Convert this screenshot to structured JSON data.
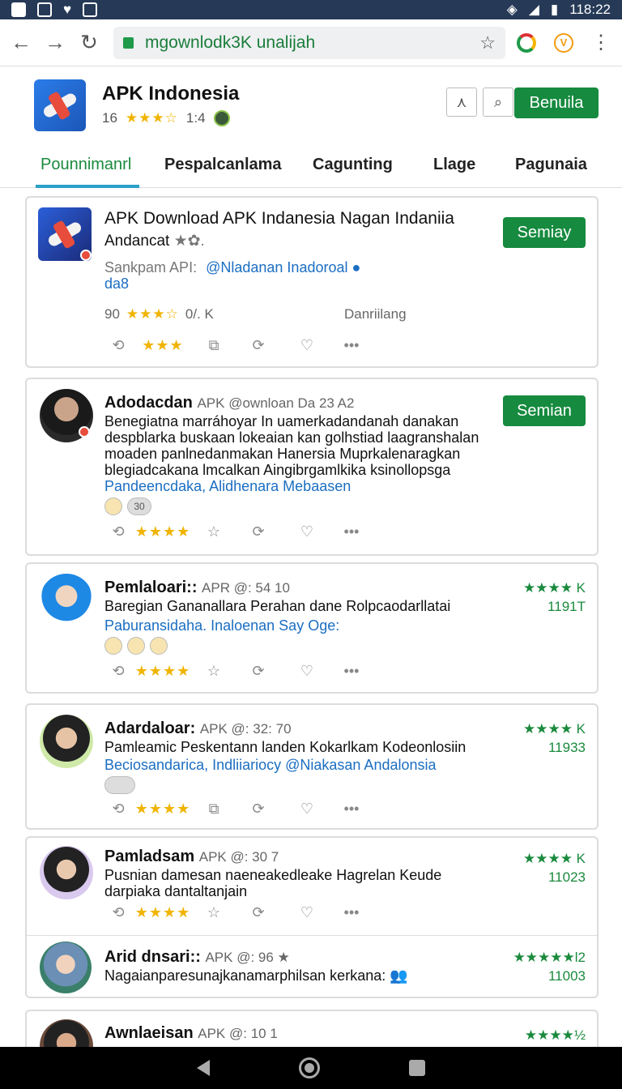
{
  "status_bar": {
    "time": "118:22"
  },
  "browser": {
    "url": "mgownlodk3K unalijah"
  },
  "app": {
    "title": "APK Indonesia",
    "count": "16",
    "stars": "★★★☆",
    "rating": "1:4",
    "action_label": "Benuila"
  },
  "tabs": [
    "Pounnimanrl",
    "Pespalcanlama",
    "Cagunting",
    "Llage",
    "Pagunaia"
  ],
  "featured": {
    "title": "APK Download APK Indanesia Nagan Indaniia",
    "subtitle": "Andancat",
    "source_label": "Sankpam API:",
    "source_link": "@Nladanan Inadoroal",
    "source_extra": "da8",
    "count": "90",
    "stars": "★★★☆",
    "size": "0/. K",
    "status": "Danriilang",
    "button": "Semiay"
  },
  "posts": [
    {
      "author": "Adodacdan",
      "handle": "APK @ownloan Da 23 A2",
      "body": "Benegiatna marráhoyar In uamerkadandanah danakan despblarka buskaan lokeaian kan golhstiad laagranshalan moaden panlnedanmakan Hanersia Muprkalenaragkan blegiadcakana lmcalkan Aingibrgamlkika ksinollopsga",
      "link": "Pandeencdaka, Alidhenara Mebaasen",
      "react_count": "30",
      "button": "Semian"
    },
    {
      "author": "Pemlaloari::",
      "handle": "APR @: 54  10",
      "body": "Baregian Gananallara Perahan dane Rolpcaodarllatai",
      "link": "Paburansidaha. Inaloenan Say Oge:",
      "rating": "★★★★ K",
      "count": "1191T"
    },
    {
      "author": "Adardaloar:",
      "handle": "APK @: 32: 70",
      "body": "Pamleamic Peskentann landen Kokarlkam Kodeonlosiin",
      "link": "Beciosandarica, Indliiariocy @Niakasan Andalonsia",
      "rating": "★★★★ K",
      "count": "11933"
    },
    {
      "author": "Pamladsam",
      "handle": "APK @: 30   7",
      "body": "Pusnian damesan naeneakedleake Hagrelan Keude darpiaka dantaltanjain",
      "rating": "★★★★ K",
      "count": "11023"
    },
    {
      "author": "Arid dnsari::",
      "handle": "APK @: 96 ★",
      "body": "Nagaianparesunajkanamarphilsan kerkana:",
      "rating": "★★★★★l2",
      "count": "11003"
    },
    {
      "author": "Awnlaeisan",
      "handle": "APK @: 10   1",
      "rating": "★★★★½"
    }
  ],
  "colors": {
    "brand_green": "#168a3f",
    "status_bar": "#263a57",
    "link": "#1b6ec2",
    "star": "#f0b400"
  }
}
